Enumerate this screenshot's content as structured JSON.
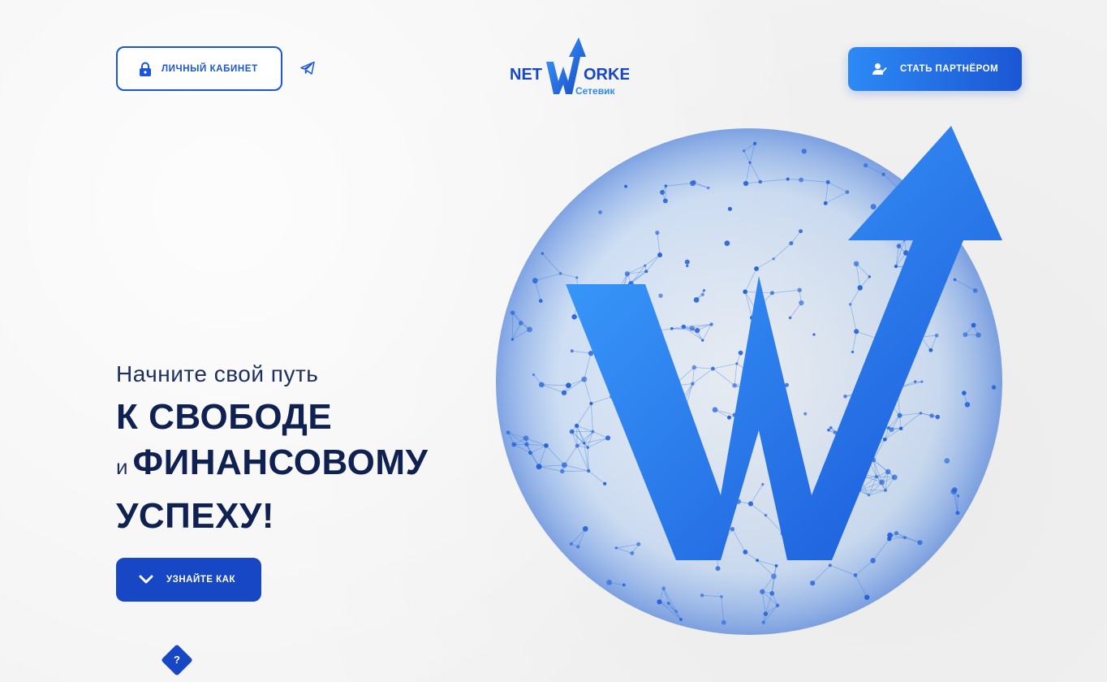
{
  "header": {
    "cabinet_button": {
      "label": "ЛИЧНЫЙ КАБИНЕТ",
      "icon": "lock-icon"
    },
    "telegram_icon": "telegram-icon",
    "logo": {
      "text_left": "NET",
      "text_right": "ORKER",
      "subtitle": "Сетевик"
    },
    "partner_button": {
      "label": "СТАТЬ ПАРТНЁРОМ",
      "icon": "user-check-icon"
    }
  },
  "hero": {
    "subtitle": "Начните свой путь",
    "line1": "К СВОБОДЕ",
    "line2_prefix": "и",
    "line2": "ФИНАНСОВОМУ",
    "line3": "УСПЕХУ!",
    "learn_button": {
      "label": "УЗНАЙТЕ КАК",
      "icon": "chevron-down-icon"
    }
  },
  "help": {
    "label": "?"
  },
  "colors": {
    "primary": "#1a56d8",
    "primary_dark": "#1747c4",
    "accent_light": "#2d8af5",
    "title": "#0f2150",
    "background": "#f3f3f3"
  }
}
